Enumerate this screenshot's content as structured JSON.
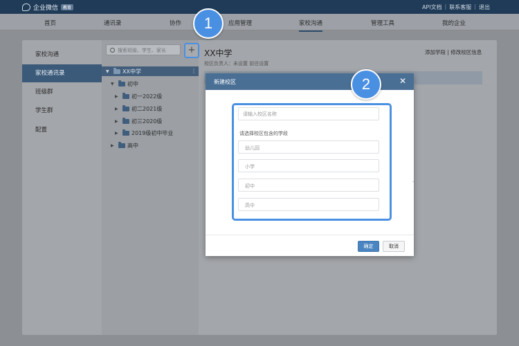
{
  "topbar": {
    "logo_text": "企业微信",
    "logo_badge": "教育",
    "links": [
      "API文档",
      "联系客服",
      "退出"
    ],
    "separator": "|"
  },
  "nav": {
    "items": [
      "首页",
      "通讯录",
      "协作",
      "应用管理",
      "家校沟通",
      "管理工具",
      "我的企业"
    ],
    "active_index": 4
  },
  "sidebar": {
    "items": [
      "家校沟通",
      "家校通讯录",
      "班级群",
      "学生群",
      "配置"
    ],
    "active_index": 1
  },
  "tree": {
    "search_placeholder": "搜索班级、学生、家长",
    "add_symbol": "+",
    "more_symbol": "⋮",
    "nodes": [
      {
        "label": "XX中学",
        "level": 0,
        "caret": "▼"
      },
      {
        "label": "初中",
        "level": 1,
        "caret": "▼"
      },
      {
        "label": "初一2022级",
        "level": 2,
        "caret": "▶"
      },
      {
        "label": "初二2021级",
        "level": 2,
        "caret": "▶"
      },
      {
        "label": "初三2020级",
        "level": 2,
        "caret": "▶"
      },
      {
        "label": "2019级初中毕业",
        "level": 2,
        "caret": "▶"
      },
      {
        "label": "高中",
        "level": 1,
        "caret": "▶"
      }
    ]
  },
  "school": {
    "title": "XX中学",
    "subtitle": "校区负责人：未设置  前往设置",
    "links": "添加学段 | 修改校区信息"
  },
  "steps": {
    "one": "1",
    "two": "2"
  },
  "modal": {
    "title": "新建校区",
    "close_symbol": "✕",
    "name_placeholder": "请输入校区名称",
    "stage_label": "请选择校区包含的学段",
    "stages": [
      "幼儿园",
      "小学",
      "初中",
      "高中"
    ],
    "ok_label": "确定",
    "cancel_label": "取消"
  },
  "colors": {
    "accent": "#4a90e2",
    "header": "#1f3b57",
    "modal_header": "#4a6f95",
    "sidebar_active": "#3b5a79"
  }
}
